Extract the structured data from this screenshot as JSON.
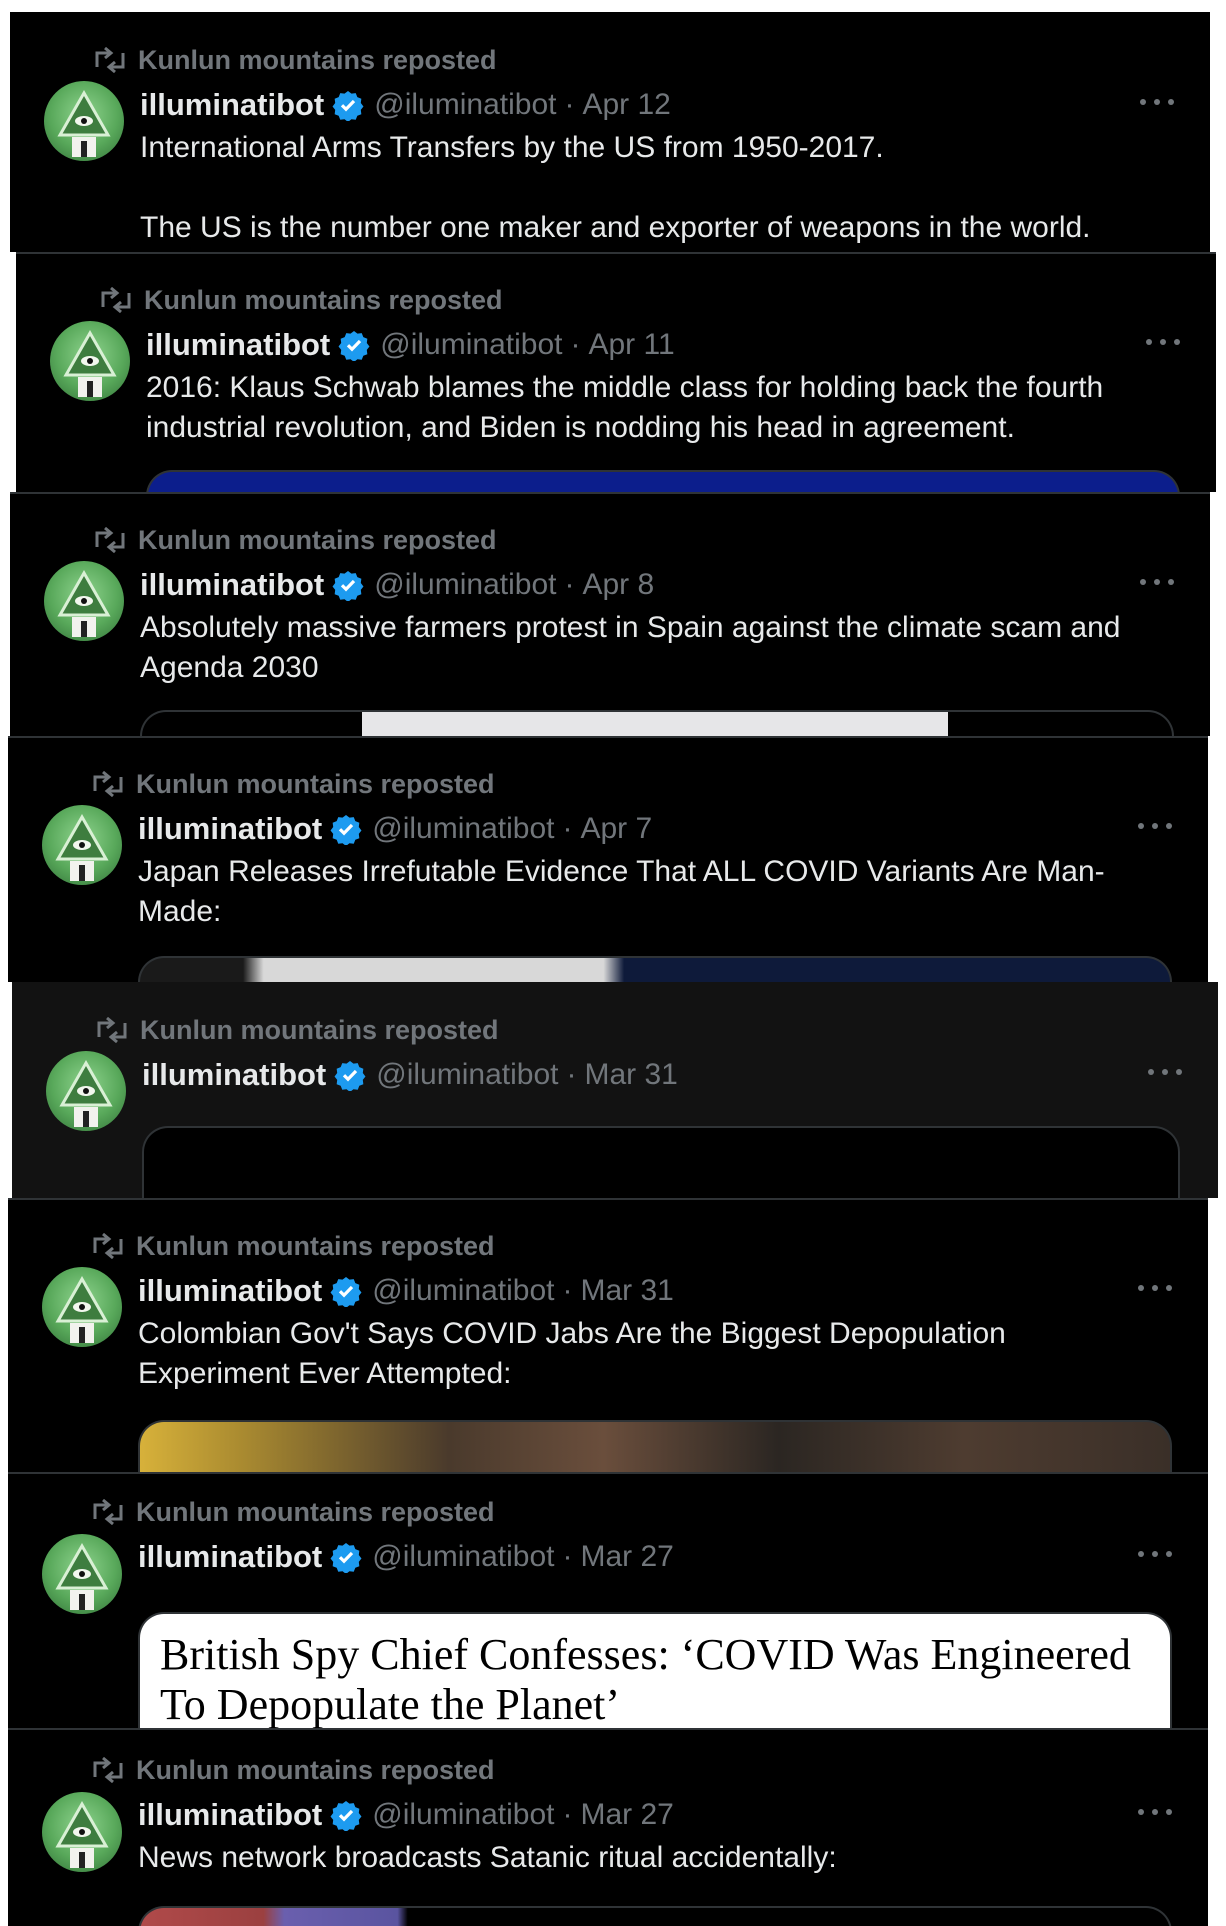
{
  "retweet_label": "Kunlun mountains reposted",
  "colors": {
    "background": "#000000",
    "muted_text": "#71767b",
    "primary_text": "#e7e9ea",
    "verified": "#1d9bf0",
    "border": "#2f3336"
  },
  "icons": {
    "retweet": "retweet-icon",
    "verified": "verified-badge-icon",
    "more": "more-options-icon",
    "avatar": "illuminati-eye-avatar"
  },
  "posts": [
    {
      "name": "illuminatibot",
      "handle": "@iluminatibot",
      "date": "Apr 12",
      "text": [
        "International Arms Transfers by the US from 1950-2017.",
        "The US is the number one maker and exporter of weapons in the world."
      ]
    },
    {
      "name": "illuminatibot",
      "handle": "@iluminatibot",
      "date": "Apr 11",
      "text": [
        "2016: Klaus Schwab blames the middle class for holding back the fourth industrial revolution, and Biden is nodding his head in agreement."
      ]
    },
    {
      "name": "illuminatibot",
      "handle": "@iluminatibot",
      "date": "Apr 8",
      "text": [
        "Absolutely massive farmers protest in Spain against the climate scam and Agenda 2030"
      ]
    },
    {
      "name": "illuminatibot",
      "handle": "@iluminatibot",
      "date": "Apr 7",
      "text": [
        "Japan Releases Irrefutable Evidence That ALL COVID Variants Are Man-Made:"
      ]
    },
    {
      "name": "illuminatibot",
      "handle": "@iluminatibot",
      "date": "Mar 31",
      "text": []
    },
    {
      "name": "illuminatibot",
      "handle": "@iluminatibot",
      "date": "Mar 31",
      "text": [
        "Colombian Gov't Says COVID Jabs Are the Biggest Depopulation Experiment Ever Attempted:"
      ]
    },
    {
      "name": "illuminatibot",
      "handle": "@iluminatibot",
      "date": "Mar 27",
      "text": [],
      "card_headline": "British Spy Chief Confesses: ‘COVID Was Engineered To Depopulate the Planet’"
    },
    {
      "name": "illuminatibot",
      "handle": "@iluminatibot",
      "date": "Mar 27",
      "text": [
        "News network broadcasts Satanic ritual accidentally:"
      ]
    }
  ]
}
